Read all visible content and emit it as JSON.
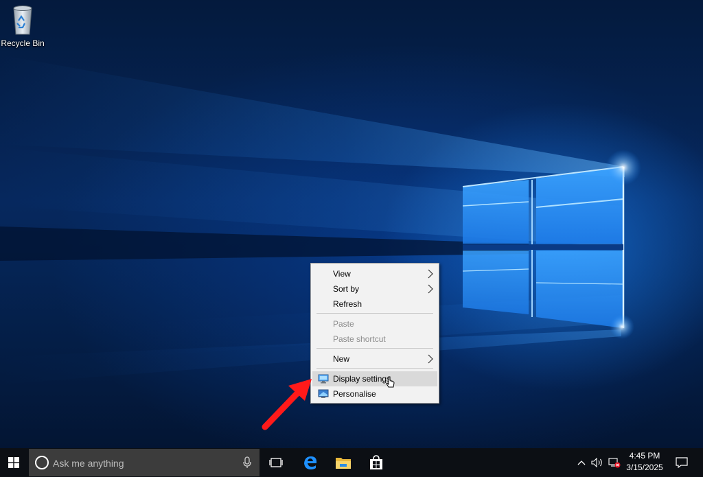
{
  "desktop": {
    "icons": [
      {
        "label": "Recycle Bin",
        "icon": "recycle-bin-icon"
      }
    ]
  },
  "context_menu": {
    "items": [
      {
        "label": "View",
        "submenu": true,
        "enabled": true
      },
      {
        "label": "Sort by",
        "submenu": true,
        "enabled": true
      },
      {
        "label": "Refresh",
        "submenu": false,
        "enabled": true
      },
      {
        "label": "Paste",
        "submenu": false,
        "enabled": false
      },
      {
        "label": "Paste shortcut",
        "submenu": false,
        "enabled": false
      },
      {
        "label": "New",
        "submenu": true,
        "enabled": true
      },
      {
        "label": "Display settings",
        "submenu": false,
        "enabled": true,
        "icon": "display-icon",
        "highlighted": true
      },
      {
        "label": "Personalise",
        "submenu": false,
        "enabled": true,
        "icon": "personalise-icon"
      }
    ]
  },
  "annotation": {
    "arrow_color": "#ff1a1a",
    "points_to": "Display settings"
  },
  "taskbar": {
    "search_placeholder": "Ask me anything",
    "pinned": [
      "task-view-icon",
      "edge-icon",
      "file-explorer-icon",
      "store-icon"
    ],
    "tray": {
      "time": "4:45 PM",
      "date": "3/15/2025"
    }
  },
  "colors": {
    "taskbar": "#0c0f14",
    "menu_background": "#f2f2f2",
    "menu_highlight": "#d9d9d9",
    "wallpaper_accent": "#1e8cff"
  }
}
